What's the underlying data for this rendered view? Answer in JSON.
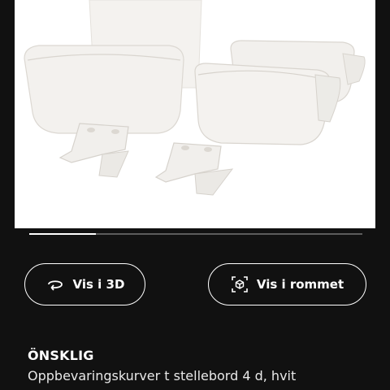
{
  "gallery": {
    "image_alt_subject": "white storage baskets for changing table",
    "progress_fraction": 0.2
  },
  "actions": {
    "view_3d_label": "Vis i 3D",
    "view_3d_icon": "rotate-3d-icon",
    "view_in_room_label": "Vis i rommet",
    "view_in_room_icon": "ar-cube-icon"
  },
  "product": {
    "name": "ÖNSKLIG",
    "description": "Oppbevaringskurver t stellebord 4 d, hvit"
  },
  "colors": {
    "background": "#111111",
    "text": "#ffffff",
    "image_bg": "#ffffff",
    "track": "#5c5c5c"
  }
}
